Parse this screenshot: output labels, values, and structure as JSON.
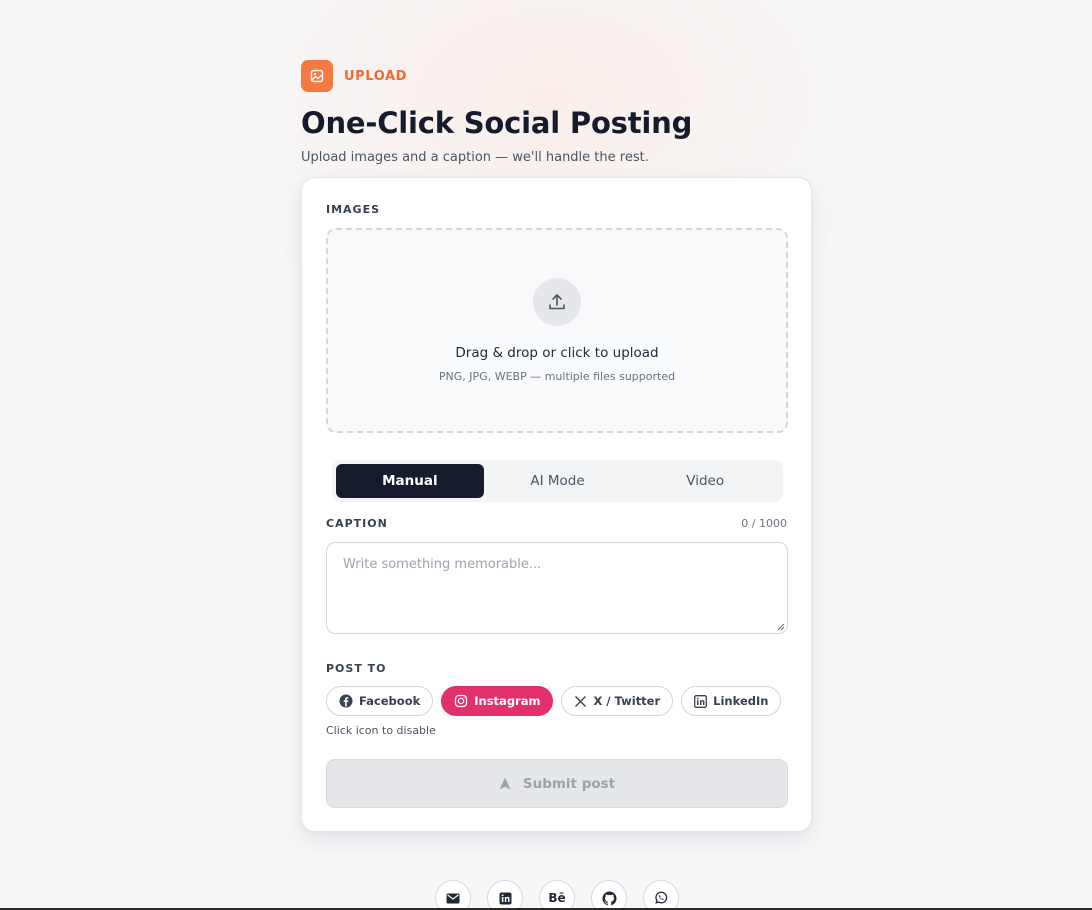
{
  "header": {
    "eyebrow": "UPLOAD",
    "title": "One-Click Social Posting",
    "subtitle": "Upload images and a caption — we'll handle the rest."
  },
  "images": {
    "label": "IMAGES",
    "dropzone_title": "Drag & drop or click to upload",
    "dropzone_hint": "PNG, JPG, WEBP — multiple files supported"
  },
  "modes": {
    "tabs": [
      "Manual",
      "AI Mode",
      "Video"
    ],
    "active": "Manual"
  },
  "caption": {
    "label": "CAPTION",
    "count": "0 / 1000",
    "placeholder": "Write something memorable...",
    "value": ""
  },
  "post_to": {
    "label": "POST TO",
    "platforms": [
      {
        "label": "Facebook",
        "icon": "facebook-icon",
        "enabled": false
      },
      {
        "label": "Instagram",
        "icon": "instagram-icon",
        "enabled": true
      },
      {
        "label": "X / Twitter",
        "icon": "x-icon",
        "enabled": false
      },
      {
        "label": "LinkedIn",
        "icon": "linkedin-icon",
        "enabled": false
      }
    ],
    "hint": "Click icon to disable"
  },
  "submit": {
    "label": "Submit post",
    "disabled": true
  },
  "footer": {
    "social": [
      {
        "icon": "mail-icon"
      },
      {
        "icon": "linkedin-icon"
      },
      {
        "icon": "behance-icon",
        "text": "Bē"
      },
      {
        "icon": "github-icon"
      },
      {
        "icon": "whatsapp-icon"
      }
    ]
  },
  "colors": {
    "accent": "#f47a42",
    "eyebrow_text": "#f26a31",
    "active_tab": "#171b2e",
    "instagram": "#e1306c"
  }
}
